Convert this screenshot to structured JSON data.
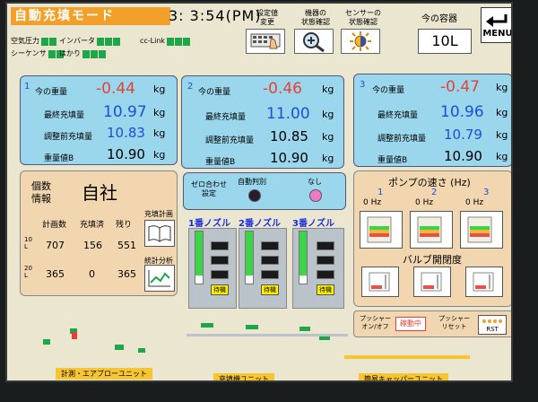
{
  "header": {
    "mode_title": "自動充填モード",
    "clock": "3: 3:54(PM)",
    "indicators": [
      {
        "label": "空気圧力",
        "states": [
          true,
          true
        ]
      },
      {
        "label": "インバータ",
        "states": [
          true,
          true,
          true
        ]
      },
      {
        "label": "cc-Link",
        "states": [
          true,
          true,
          true
        ]
      },
      {
        "label": "シーケンサ",
        "states": [
          true,
          true
        ]
      },
      {
        "label": "はかり",
        "states": [
          true,
          true,
          true
        ]
      }
    ],
    "buttons": [
      {
        "label": "設定値\n変更",
        "icon": "keyboard-hand-icon"
      },
      {
        "label": "機器の\n状態確認",
        "icon": "magnifier-icon"
      },
      {
        "label": "センサーの\n状態確認",
        "icon": "sensor-sun-icon"
      }
    ],
    "container_label": "今の容器",
    "container_value": "10L",
    "menu_label": "MENU"
  },
  "panels": [
    {
      "num": "1",
      "current_label": "今の重量",
      "current": "-0.44",
      "final_label": "最終充填量",
      "final": "10.97",
      "adj_label": "調整前充填量",
      "adj": "10.83",
      "target_label": "重量値B",
      "target": "10.90",
      "unit": "kg"
    },
    {
      "num": "2",
      "current_label": "今の重量",
      "current": "-0.46",
      "final_label": "最終充填量",
      "final": "11.00",
      "adj_label": "調整前充填量",
      "adj": "10.85",
      "target_label": "重量値B",
      "target": "10.90",
      "unit": "kg"
    },
    {
      "num": "3",
      "current_label": "今の重量",
      "current": "-0.47",
      "final_label": "最終充填量",
      "final": "10.96",
      "adj_label": "調整前充填量",
      "adj": "10.79",
      "target_label": "重量値B",
      "target": "10.90",
      "unit": "kg"
    }
  ],
  "count_panel": {
    "title_line1": "個数",
    "title_line2": "情報",
    "company": "自社",
    "col_headers": [
      "計画数",
      "充填済",
      "残り"
    ],
    "rows": [
      {
        "label": "10\nL",
        "planned": "707",
        "filled": "156",
        "remaining": "551"
      },
      {
        "label": "20\nL",
        "planned": "365",
        "filled": "0",
        "remaining": "365"
      }
    ],
    "plan_button": "充填計画",
    "stats_button": "統計分析"
  },
  "zero_panel": {
    "title": "ゼロ合わせ\n設定",
    "auto_label": "自動判別",
    "none_label": "なし"
  },
  "nozzles": [
    {
      "label": "1番ノズル",
      "status": "待機",
      "level": 0.85
    },
    {
      "label": "2番ノズル",
      "status": "待機",
      "level": 0.85
    },
    {
      "label": "3番ノズル",
      "status": "待機",
      "level": 0.85
    }
  ],
  "pump_panel": {
    "title": "ポンプの速さ (Hz)",
    "pumps": [
      {
        "num": "1",
        "value": "0 Hz"
      },
      {
        "num": "2",
        "value": "0 Hz"
      },
      {
        "num": "3",
        "value": "0 Hz"
      }
    ],
    "valve_title": "バルブ開閉度"
  },
  "pusher": {
    "onoff_label": "プッシャー\nオン/オフ",
    "onoff_state": "稼動中",
    "reset_label": "プッシャー\nリセット",
    "rst_label": "RST"
  },
  "bottom_labels": [
    "計測・エアブローユニット",
    "充填機ユニット",
    "簡易キャッパーユニット"
  ],
  "colors": {
    "title_bg": "#f2a02a",
    "panel_bg": "#9ad6ec",
    "value_blue": "#1b50d8",
    "value_red": "#e34237",
    "indicator_green": "#1fa54a",
    "nozzle_green": "#3fd34a",
    "screen_bg": "#eae6cf"
  }
}
